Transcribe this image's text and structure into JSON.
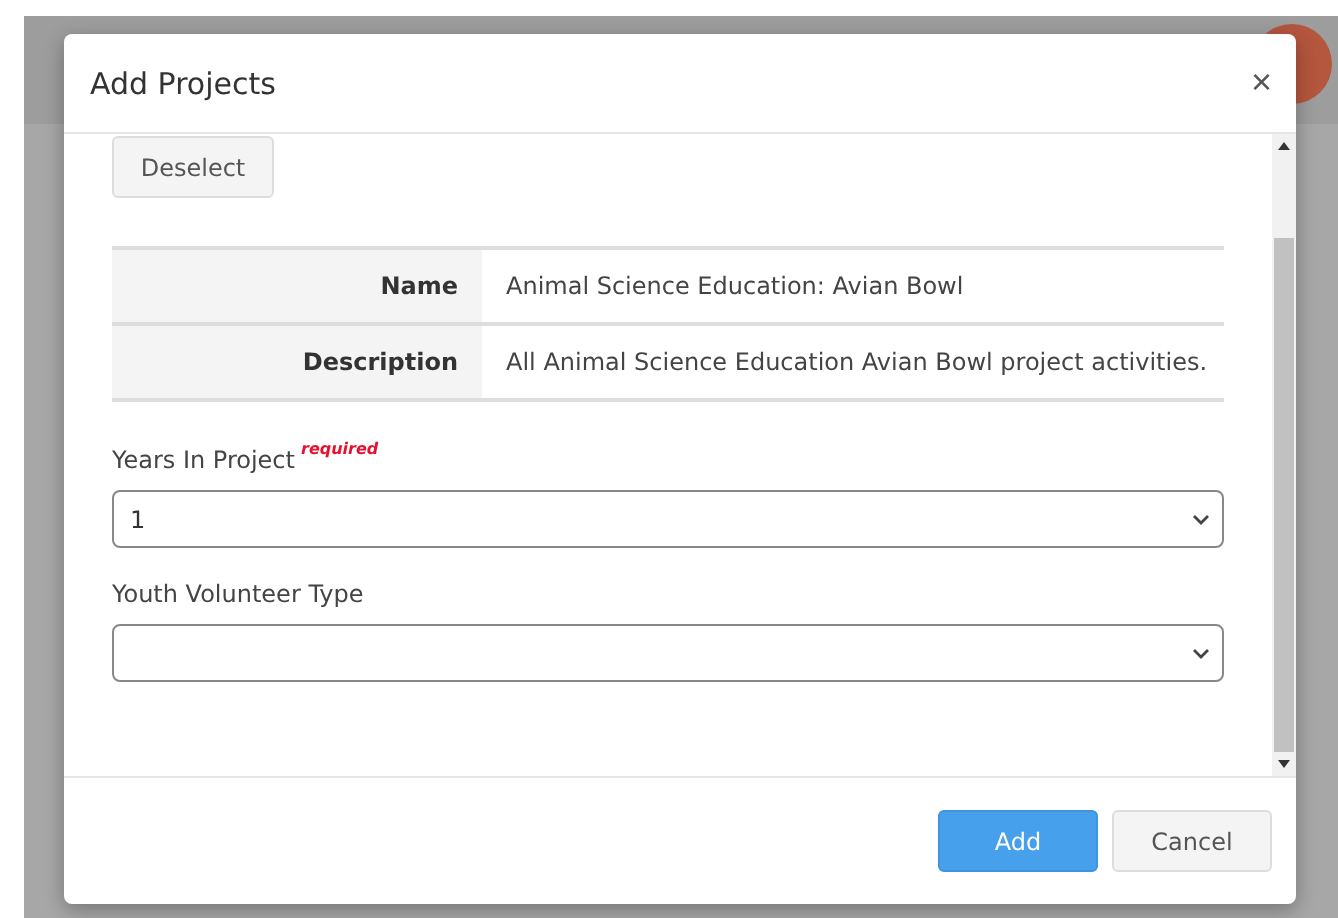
{
  "dialog": {
    "title": "Add Projects",
    "close": "×"
  },
  "deselect_button": "Deselect",
  "details": [
    {
      "label": "Name",
      "value": "Animal Science Education: Avian Bowl"
    },
    {
      "label": "Description",
      "value": "All Animal Science Education Avian Bowl project activities."
    }
  ],
  "fields": [
    {
      "label": "Years In Project",
      "required_note": "required",
      "value": "1"
    },
    {
      "label": "Youth Volunteer Type"
    }
  ],
  "buttons": [
    {
      "label": "Add",
      "kind": "primary"
    },
    {
      "label": "Cancel",
      "kind": "secondary"
    }
  ]
}
